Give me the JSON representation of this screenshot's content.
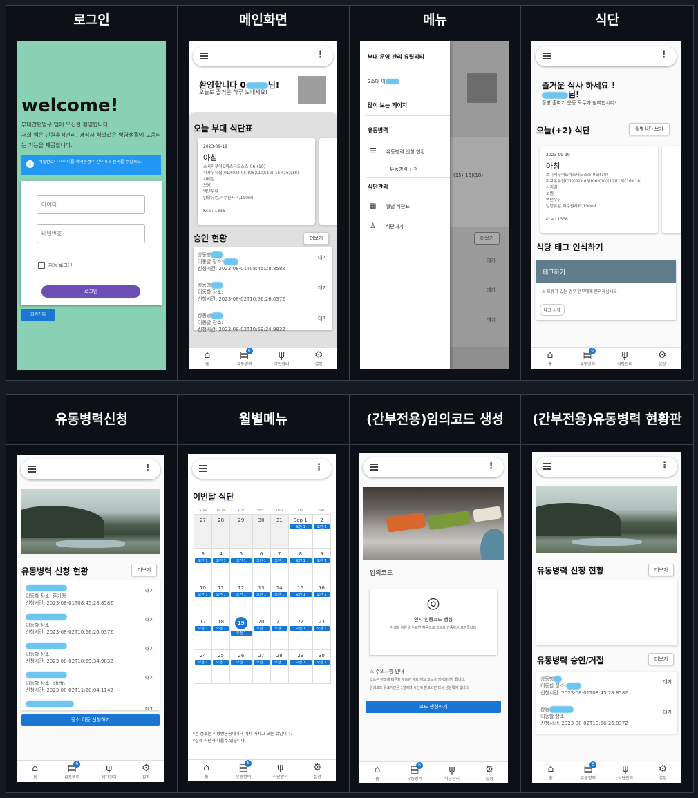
{
  "headers": {
    "login": "로그인",
    "main": "메인화면",
    "menu": "메뉴",
    "diet": "식단",
    "apply": "유동병력신청",
    "monthly": "월별메뉴",
    "code": "(간부전용)임의코드 생성",
    "board": "(간부전용)유동병력 현황판"
  },
  "login": {
    "welcome": "welcome!",
    "desc": "부대간편업무 앱에 오신걸 환영합니다.\n저희 앱은 인원추적관리, 경식자 식별같은 병영생활에 도움되는 기능을 제공합니다.",
    "alert": "비밀번호나 아이디를 까먹은경우 간부에게 문의를 주십시오.",
    "id_ph": "아이디",
    "pw_ph": "비밀번호",
    "auto": "자동 로그인",
    "login_btn": "로그인",
    "signup": "회원가입"
  },
  "tabbar": {
    "home": "홈",
    "troop": "유동병력",
    "diet": "식단관리",
    "settings": "설정",
    "badge": "6"
  },
  "main": {
    "welcome": "환영합니다 0",
    "suffix": "님!",
    "sub": "오늘도 즐거운 하루 보내세요!",
    "menu_title": "오늘 부대 식단표",
    "date": "2023-09-19",
    "meal": "아침",
    "items": "소시지구이&미스터드소스(06)(10)\n파자우유첩(01)(02)(05)(06)(10)(12)(15)(16)(18)\n시리얼\n보쌈\n백년우유\n남양유업,과수원사과,190ml",
    "kcal": "Kcal: 1336",
    "approve_title": "승인 현황",
    "more": "더보기",
    "rows": [
      {
        "name": "상동병",
        "place": "이동할 장소:",
        "time": "신청시간: 2023-08-01T08:45:28.858Z",
        "status": "대기"
      },
      {
        "name": "상동병",
        "place": "이동할 장소:",
        "time": "신청시간: 2023-08-02T10:56:26.037Z",
        "status": "대기"
      },
      {
        "name": "상동병",
        "place": "이동할 장소:",
        "time": "신청시간: 2023-08-02T10:59:34.983Z",
        "status": "대기"
      }
    ]
  },
  "menu": {
    "title": "부대 운영 관리 유틸리티",
    "user": "2소대 이",
    "popular": "많이 보는 페이지",
    "sec1": "유동병력",
    "item1": "유동병력 신청 현황",
    "item2": "유동병력 신청",
    "sec2": "식단관리",
    "item3": "월별 식단표",
    "item4": "식단대기"
  },
  "diet": {
    "title": "즐거운 식사 하세요 !",
    "suffix": "님!",
    "sub": "장병 출여기 운동 모두가 참여합시다!",
    "today": "오늘(+2) 식단",
    "month_btn": "월별식단 보기",
    "date": "2023-09-19",
    "meal": "아침",
    "tag_title": "식당 태그 인식하기",
    "tag_head": "태그하기",
    "tag_warn": "⚠ 오류가 있는 경우 간부에게 문의하십시오",
    "tag_btn": "태그 시작"
  },
  "apply": {
    "title": "유동병력 신청 현황",
    "more": "더보기",
    "rows": [
      {
        "place": "이동할 장소: 훈가정",
        "time": "신청시간: 2023-08-01T08:45:28.858Z",
        "status": "대기"
      },
      {
        "place": "이동할 장소:",
        "time": "신청시간: 2023-08-02T10:56:26.037Z",
        "status": "대기"
      },
      {
        "place": "이동할 장소:",
        "time": "신청시간: 2023-08-02T10:59:34.983Z",
        "status": "대기"
      },
      {
        "place": "이동할 장소: ahffn",
        "time": "신청시간: 2023-08-02T11:20:04.114Z",
        "status": "대기"
      },
      {
        "place": "",
        "time": "",
        "status": "대기"
      }
    ],
    "btn": "장소 이동 신청하기"
  },
  "monthly": {
    "title": "이번달 식단",
    "days": [
      "SUN",
      "MON",
      "TUE",
      "WED",
      "THU",
      "FRI",
      "SAT"
    ],
    "weeks": [
      [
        "27",
        "28",
        "29",
        "30",
        "31",
        "Sep 1",
        "2"
      ],
      [
        "3",
        "4",
        "5",
        "6",
        "7",
        "8",
        "9"
      ],
      [
        "10",
        "11",
        "12",
        "13",
        "14",
        "15",
        "16"
      ],
      [
        "17",
        "18",
        "19",
        "20",
        "21",
        "22",
        "23"
      ],
      [
        "24",
        "25",
        "26",
        "27",
        "28",
        "29",
        "30"
      ]
    ],
    "ev": "오전 1",
    "note1": "*본 정보는 식방방공공데이터 에서 가지고 오는 것입니다.",
    "note2": "*실제 식단과 다를수 있습니다."
  },
  "code": {
    "label": "임의코드",
    "card_title": "인시 인증코드 생성",
    "card_sub": "아래에 버튼을 누르면 처음으로 코드로 인증하시 모여줍니다",
    "warn": "⚠ 주의사항 안내",
    "warn1": "코드는 아래에 버튼을 누르면 새로 해요 코드가 생성되어서 됩니다.",
    "warn2": "임의코드 유효기간은 1일이며 시간이 만료되면 다시 생성해야 합니다.",
    "btn": "코드 생성하기"
  },
  "board": {
    "title": "유동병력 신청 현황",
    "more": "더보기",
    "title2": "유동병력 승인/거절",
    "more2": "더보기",
    "rows": [
      {
        "name": "상동병",
        "place": "이동할 장소:",
        "time": "신청시간: 2023-08-01T08:45:28.858Z",
        "status": "대기"
      },
      {
        "name": "상동",
        "place": "이동할 장소:",
        "time": "신청시간: 2023-08-02T10:56:26.037Z",
        "status": "대기"
      }
    ]
  },
  "colors": {
    "teal": "#88d1b5",
    "blue": "#1976d2",
    "purple": "#6c4fb4"
  }
}
